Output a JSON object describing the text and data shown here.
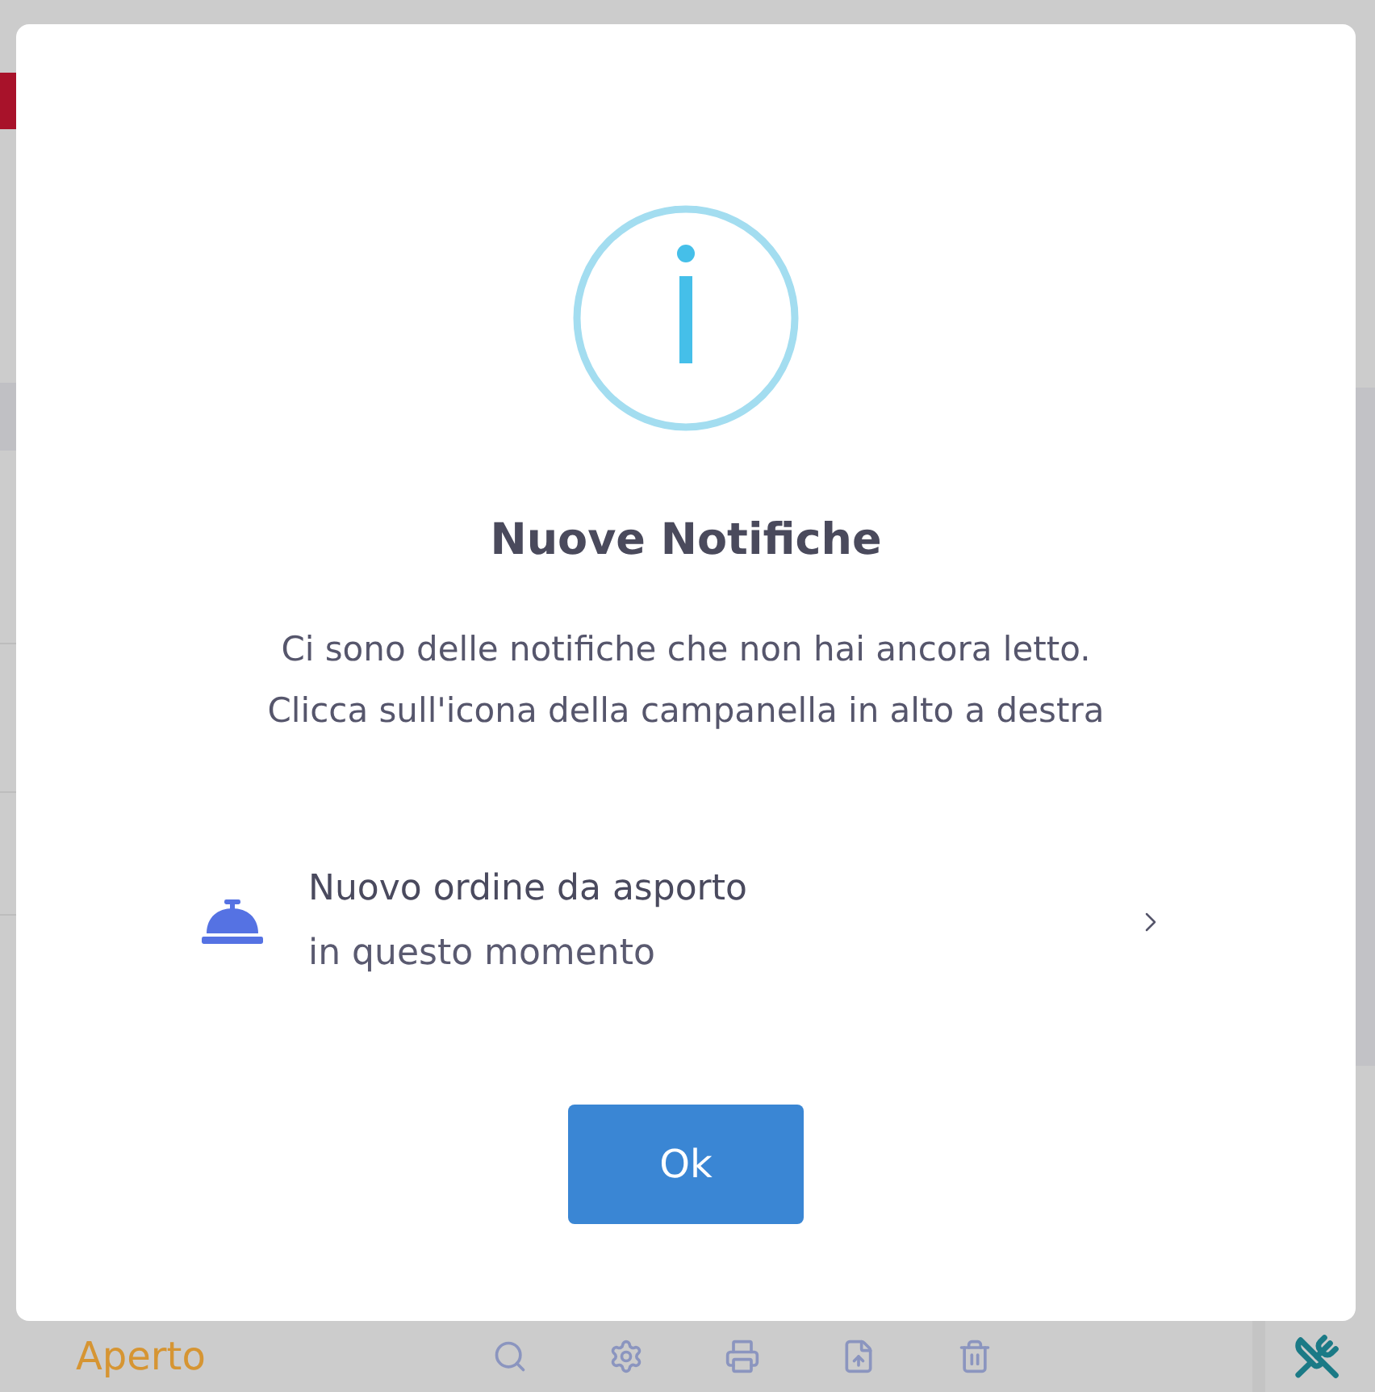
{
  "background": {
    "status_label": "Aperto"
  },
  "dialog": {
    "title": "Nuove Notifiche",
    "message_lines": [
      "Ci sono delle notifiche che non hai ancora letto.",
      "Clicca sull'icona della campanella in alto a destra"
    ],
    "notifications": [
      {
        "title": "Nuovo ordine da asporto",
        "time": "in questo momento"
      }
    ],
    "button": "Ok"
  }
}
